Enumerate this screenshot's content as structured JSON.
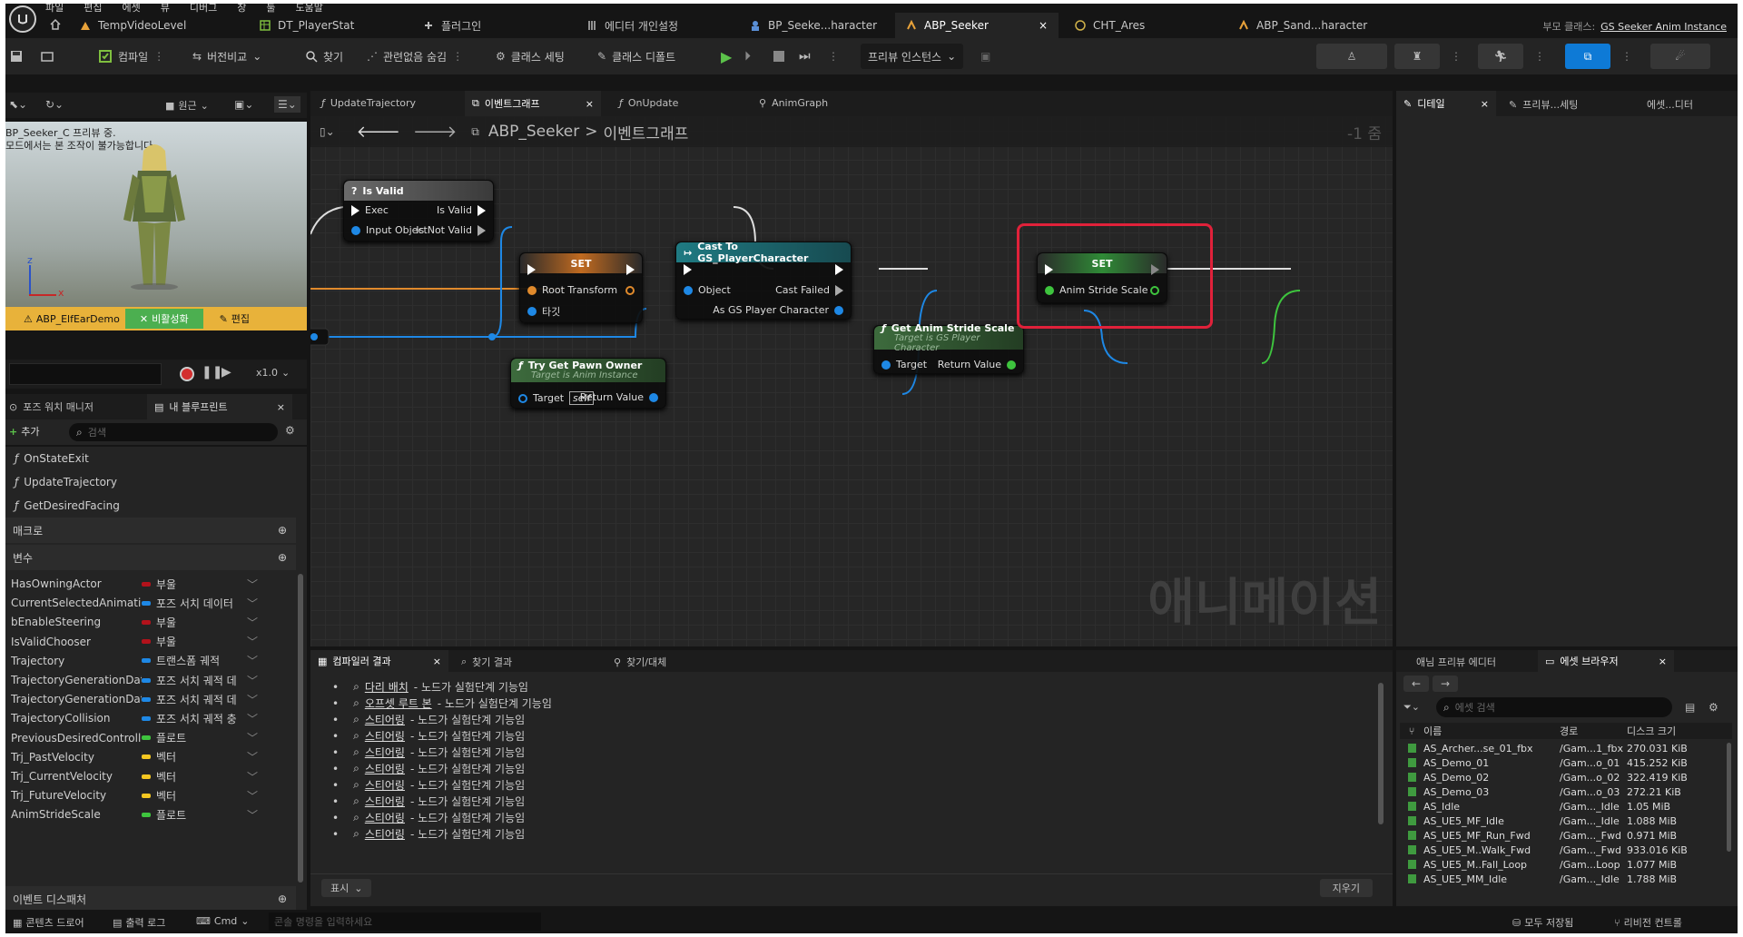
{
  "menu": [
    "파일",
    "편집",
    "에셋",
    "뷰",
    "디버그",
    "창",
    "툴",
    "도움말"
  ],
  "tabs": [
    {
      "label": "TempVideoLevel"
    },
    {
      "label": "DT_PlayerStat"
    },
    {
      "label": "플러그인"
    },
    {
      "label": "에디터 개인설정"
    },
    {
      "label": "BP_Seeke...haracter"
    },
    {
      "label": "ABP_Seeker",
      "close": "×"
    },
    {
      "label": "CHT_Ares"
    },
    {
      "label": "ABP_Sand...haracter"
    }
  ],
  "parent_class": {
    "label": "부모 클래스:",
    "value": "GS Seeker Anim Instance"
  },
  "toolbar": {
    "compile": "컴파일",
    "diff": "버전비교",
    "find": "찾기",
    "hide": "관련없음 숨김",
    "class_settings": "클래스 세팅",
    "class_defaults": "클래스 디폴트",
    "preview_instance": "프리뷰 인스턴스"
  },
  "graph_tabs": [
    {
      "label": "UpdateTrajectory"
    },
    {
      "label": "이벤트그래프",
      "close": "×"
    },
    {
      "label": "OnUpdate"
    },
    {
      "label": "AnimGraph"
    }
  ],
  "right_tabs": [
    {
      "label": "디테일",
      "close": "×"
    },
    {
      "label": "프리뷰...세팅"
    },
    {
      "label": "에셋...디터"
    }
  ],
  "breadcrumb": {
    "root": "ABP_Seeker",
    "sep": ">",
    "current": "이벤트그래프",
    "zoom": "-1 줌"
  },
  "viewport": {
    "text1": "BP_Seeker_C 프리뷰 중.",
    "text2": "모드에서는 본 조작이 불가능합니다.",
    "axis_z": "z",
    "axis_x": "x",
    "bar_left": "ABP_ElfEarDemo",
    "bar_mid": "비활성화",
    "bar_right": "편집",
    "speed": "x1.0",
    "btn_perspective": "원근"
  },
  "left_tabs": {
    "pose": "포즈 워치 매니저",
    "bp": "내 블루프린트",
    "close": "×"
  },
  "left_add": "추가",
  "left_search_placeholder": "검색",
  "functions": [
    "OnStateExit",
    "UpdateTrajectory",
    "GetDesiredFacing"
  ],
  "sections": {
    "macro": "매크로",
    "variables": "변수",
    "dispatchers": "이벤트 디스패처"
  },
  "variables": [
    {
      "name": "HasOwningActor",
      "type": "부울",
      "color": "#b3121b"
    },
    {
      "name": "CurrentSelectedAnimation",
      "type": "포즈 서치 데이터",
      "color": "#1e88e5"
    },
    {
      "name": "bEnableSteering",
      "type": "부울",
      "color": "#b3121b"
    },
    {
      "name": "IsValidChooser",
      "type": "부울",
      "color": "#b3121b"
    },
    {
      "name": "Trajectory",
      "type": "트랜스폼 궤적",
      "color": "#1e88e5"
    },
    {
      "name": "TrajectoryGenerationData_Idl",
      "type": "포즈 서치 궤적 데",
      "color": "#1e88e5"
    },
    {
      "name": "TrajectoryGenerationData_Mc",
      "type": "포즈 서치 궤적 데",
      "color": "#1e88e5"
    },
    {
      "name": "TrajectoryCollision",
      "type": "포즈 서치 궤적 충",
      "color": "#1e88e5"
    },
    {
      "name": "PreviousDesiredControllerYa",
      "type": "플로트",
      "color": "#3ec43e"
    },
    {
      "name": "Trj_PastVelocity",
      "type": "벡터",
      "color": "#f3c621"
    },
    {
      "name": "Trj_CurrentVelocity",
      "type": "벡터",
      "color": "#f3c621"
    },
    {
      "name": "Trj_FutureVelocity",
      "type": "벡터",
      "color": "#f3c621"
    },
    {
      "name": "AnimStrideScale",
      "type": "플로트",
      "color": "#3ec43e"
    }
  ],
  "nodes": {
    "isvalid": {
      "title": "Is Valid",
      "exec": "Exec",
      "isvalid": "Is Valid",
      "input": "Input Object",
      "notvalid": "Is Not Valid"
    },
    "set1": {
      "title": "SET",
      "root": "Root Transform",
      "target": "타깃"
    },
    "cast": {
      "title": "Cast To GS_PlayerCharacter",
      "object": "Object",
      "failed": "Cast Failed",
      "as": "As GS Player Character"
    },
    "pawn": {
      "title": "Try Get Pawn Owner",
      "sub": "Target is Anim Instance",
      "target": "Target",
      "self": "self",
      "ret": "Return Value"
    },
    "getstride": {
      "title": "Get Anim Stride Scale",
      "sub": "Target is GS Player Character",
      "target": "Target",
      "ret": "Return Value"
    },
    "set2": {
      "title": "SET",
      "pin": "Anim Stride Scale"
    }
  },
  "watermark": "애니메이션",
  "bottom_tabs": [
    {
      "label": "컴파일러 결과",
      "close": "×"
    },
    {
      "label": "찾기 결과"
    },
    {
      "label": "찾기/대체"
    }
  ],
  "results": [
    {
      "node": "다리 배치",
      "msg": "- 노드가 실험단계 기능임"
    },
    {
      "node": "오프셋 루트 본",
      "msg": "- 노드가 실험단계 기능임"
    },
    {
      "node": "스티어링",
      "msg": "- 노드가 실험단계 기능임"
    },
    {
      "node": "스티어링",
      "msg": "- 노드가 실험단계 기능임"
    },
    {
      "node": "스티어링",
      "msg": "- 노드가 실험단계 기능임"
    },
    {
      "node": "스티어링",
      "msg": "- 노드가 실험단계 기능임"
    },
    {
      "node": "스티어링",
      "msg": "- 노드가 실험단계 기능임"
    },
    {
      "node": "스티어링",
      "msg": "- 노드가 실험단계 기능임"
    },
    {
      "node": "스티어링",
      "msg": "- 노드가 실험단계 기능임"
    },
    {
      "node": "스티어링",
      "msg": "- 노드가 실험단계 기능임"
    }
  ],
  "show_btn": "표시",
  "clear_btn": "지우기",
  "asset_tabs": [
    {
      "label": "애님 프리뷰 에디터"
    },
    {
      "label": "에셋 브라우저",
      "close": "×"
    }
  ],
  "asset_search_placeholder": "에셋 검색",
  "asset_headers": {
    "name": "이름",
    "path": "경로",
    "size": "디스크 크기"
  },
  "assets": [
    {
      "name": "AS_Archer...se_01_fbx",
      "path": "/Gam...1_fbx",
      "size": "270.031 KiB"
    },
    {
      "name": "AS_Demo_01",
      "path": "/Gam...o_01",
      "size": "415.252 KiB"
    },
    {
      "name": "AS_Demo_02",
      "path": "/Gam...o_02",
      "size": "322.419 KiB"
    },
    {
      "name": "AS_Demo_03",
      "path": "/Gam...o_03",
      "size": "272.21 KiB"
    },
    {
      "name": "AS_Idle",
      "path": "/Gam..._Idle",
      "size": "1.05 MiB"
    },
    {
      "name": "AS_UE5_MF_Idle",
      "path": "/Gam..._Idle",
      "size": "1.088 MiB"
    },
    {
      "name": "AS_UE5_MF_Run_Fwd",
      "path": "/Gam..._Fwd",
      "size": "0.971 MiB"
    },
    {
      "name": "AS_UE5_M..Walk_Fwd",
      "path": "/Gam..._Fwd",
      "size": "933.016 KiB"
    },
    {
      "name": "AS_UE5_M..Fall_Loop",
      "path": "/Gam...Loop",
      "size": "1.077 MiB"
    },
    {
      "name": "AS_UE5_MM_Idle",
      "path": "/Gam..._Idle",
      "size": "1.788 MiB"
    }
  ],
  "status": {
    "content": "콘텐츠 드로어",
    "output": "출력 로그",
    "cmd": "Cmd",
    "cmd_placeholder": "콘솔 명령을 입력하세요",
    "save_all": "모두 저장됨",
    "revision": "리비전 컨트롤"
  }
}
